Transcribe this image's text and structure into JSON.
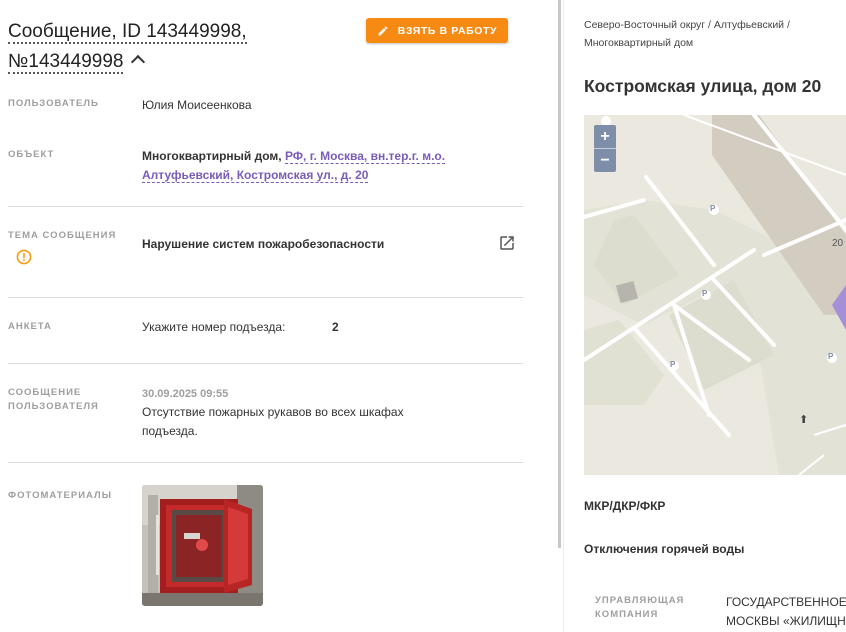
{
  "header": {
    "title_line1": "Сообщение, ID 143449998,",
    "title_line2": "№143449998",
    "take_button": "ВЗЯТЬ В РАБОТУ"
  },
  "fields": {
    "user": {
      "label": "ПОЛЬЗОВАТЕЛЬ",
      "value": "Юлия Моисеенкова"
    },
    "object": {
      "label": "ОБЪЕКТ",
      "type": "Многоквартирный дом,",
      "address_line1": "РФ, г. Москва, вн.тер.г. м.о.",
      "address_line2": "Алтуфьевский, Костромская ул., д. 20"
    },
    "topic": {
      "label": "ТЕМА СООБЩЕНИЯ",
      "value": "Нарушение систем пожаробезопасности"
    },
    "form": {
      "label": "АНКЕТА",
      "question": "Укажите номер подъезда:",
      "answer": "2"
    },
    "message": {
      "label_line1": "СООБЩЕНИЕ",
      "label_line2": "ПОЛЬЗОВАТЕЛЯ",
      "date": "30.09.2025 09:55",
      "text_line1": "Отсутствие пожарных рукавов во всех шкафах",
      "text_line2": "подъезда."
    },
    "photos": {
      "label": "ФОТОМАТЕРИАЛЫ"
    }
  },
  "right": {
    "breadcrumb_line1": "Северо-Восточный округ / Алтуфьевский /",
    "breadcrumb_line2": "Многоквартирный дом",
    "address_title": "Костромская улица, дом 20",
    "map": {
      "zoom_in": "+",
      "zoom_out": "−",
      "parking_marker": "P",
      "house_number": "20"
    },
    "mkr_label": "МКР/ДКР/ФКР",
    "hot_water_label": "Отключения горячей воды",
    "management": {
      "label_line1": "УПРАВЛЯЮЩАЯ",
      "label_line2": "КОМПАНИЯ",
      "value_line1": "ГОСУДАРСТВЕННОЕ",
      "value_line2": "МОСКВЫ «ЖИЛИЩН"
    }
  },
  "colors": {
    "accent_orange": "#f68a13",
    "link_purple": "#7a5cb6",
    "label_gray": "#9e9e9e",
    "warning_orange": "#f39c12"
  }
}
